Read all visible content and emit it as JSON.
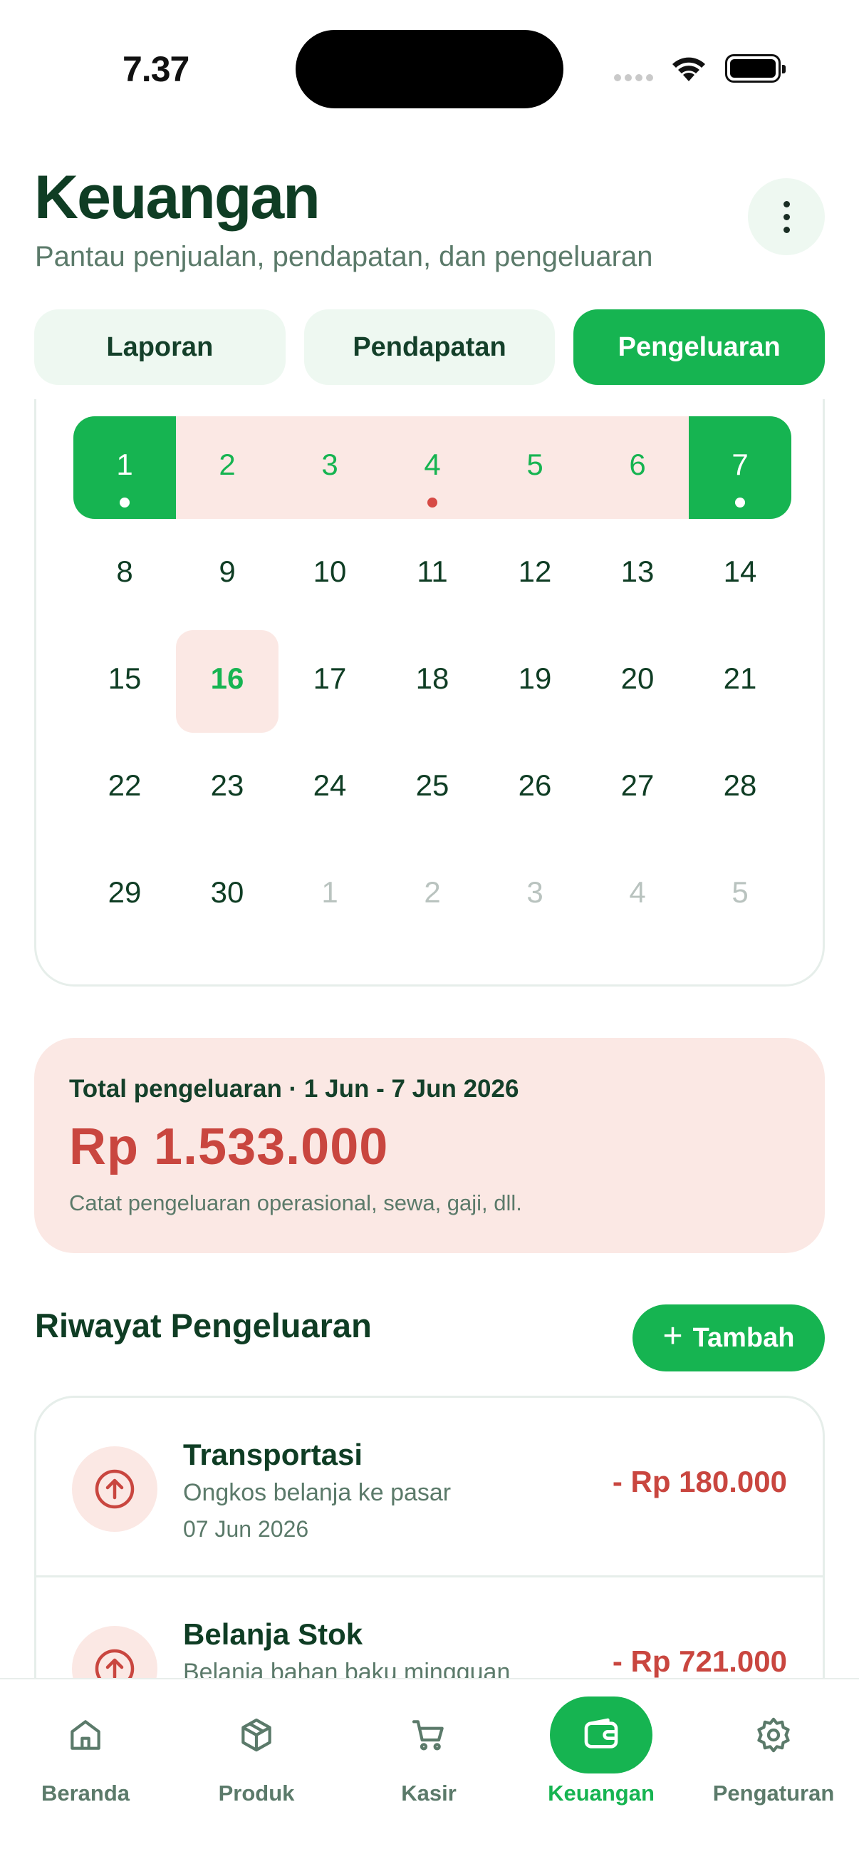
{
  "status_bar": {
    "time": "7.37"
  },
  "header": {
    "title": "Keuangan",
    "subtitle": "Pantau penjualan, pendapatan, dan pengeluaran",
    "more_icon": "more-vertical-icon"
  },
  "tabs": [
    {
      "label": "Laporan",
      "active": false
    },
    {
      "label": "Pendapatan",
      "active": false
    },
    {
      "label": "Pengeluaran",
      "active": true
    }
  ],
  "calendar": {
    "rows": [
      [
        "1",
        "2",
        "3",
        "4",
        "5",
        "6",
        "7"
      ],
      [
        "8",
        "9",
        "10",
        "11",
        "12",
        "13",
        "14"
      ],
      [
        "15",
        "16",
        "17",
        "18",
        "19",
        "20",
        "21"
      ],
      [
        "22",
        "23",
        "24",
        "25",
        "26",
        "27",
        "28"
      ],
      [
        "29",
        "30",
        "1",
        "2",
        "3",
        "4",
        "5"
      ]
    ],
    "selected_range": [
      "1",
      "7"
    ],
    "today": "16"
  },
  "summary": {
    "label": "Total pengeluaran · 1 Jun - 7 Jun 2026",
    "amount": "Rp 1.533.000",
    "note": "Catat pengeluaran operasional, sewa, gaji, dll."
  },
  "history": {
    "title": "Riwayat Pengeluaran",
    "add_label": "Tambah",
    "items": [
      {
        "title": "Transportasi",
        "desc": "Ongkos belanja ke pasar",
        "date": "07 Jun 2026",
        "amount": "- Rp 180.000"
      },
      {
        "title": "Belanja Stok",
        "desc": "Belanja bahan baku mingguan",
        "date": "",
        "amount": "- Rp 721.000"
      }
    ]
  },
  "nav": [
    {
      "label": "Beranda",
      "icon": "home-icon",
      "active": false
    },
    {
      "label": "Produk",
      "icon": "package-icon",
      "active": false
    },
    {
      "label": "Kasir",
      "icon": "cart-icon",
      "active": false
    },
    {
      "label": "Keuangan",
      "icon": "wallet-icon",
      "active": true
    },
    {
      "label": "Pengaturan",
      "icon": "gear-icon",
      "active": false
    }
  ],
  "colors": {
    "accent": "#16b451",
    "expense": "#c9463f",
    "expense_bg": "#fbe8e4",
    "tab_bg": "#eef8f1"
  }
}
